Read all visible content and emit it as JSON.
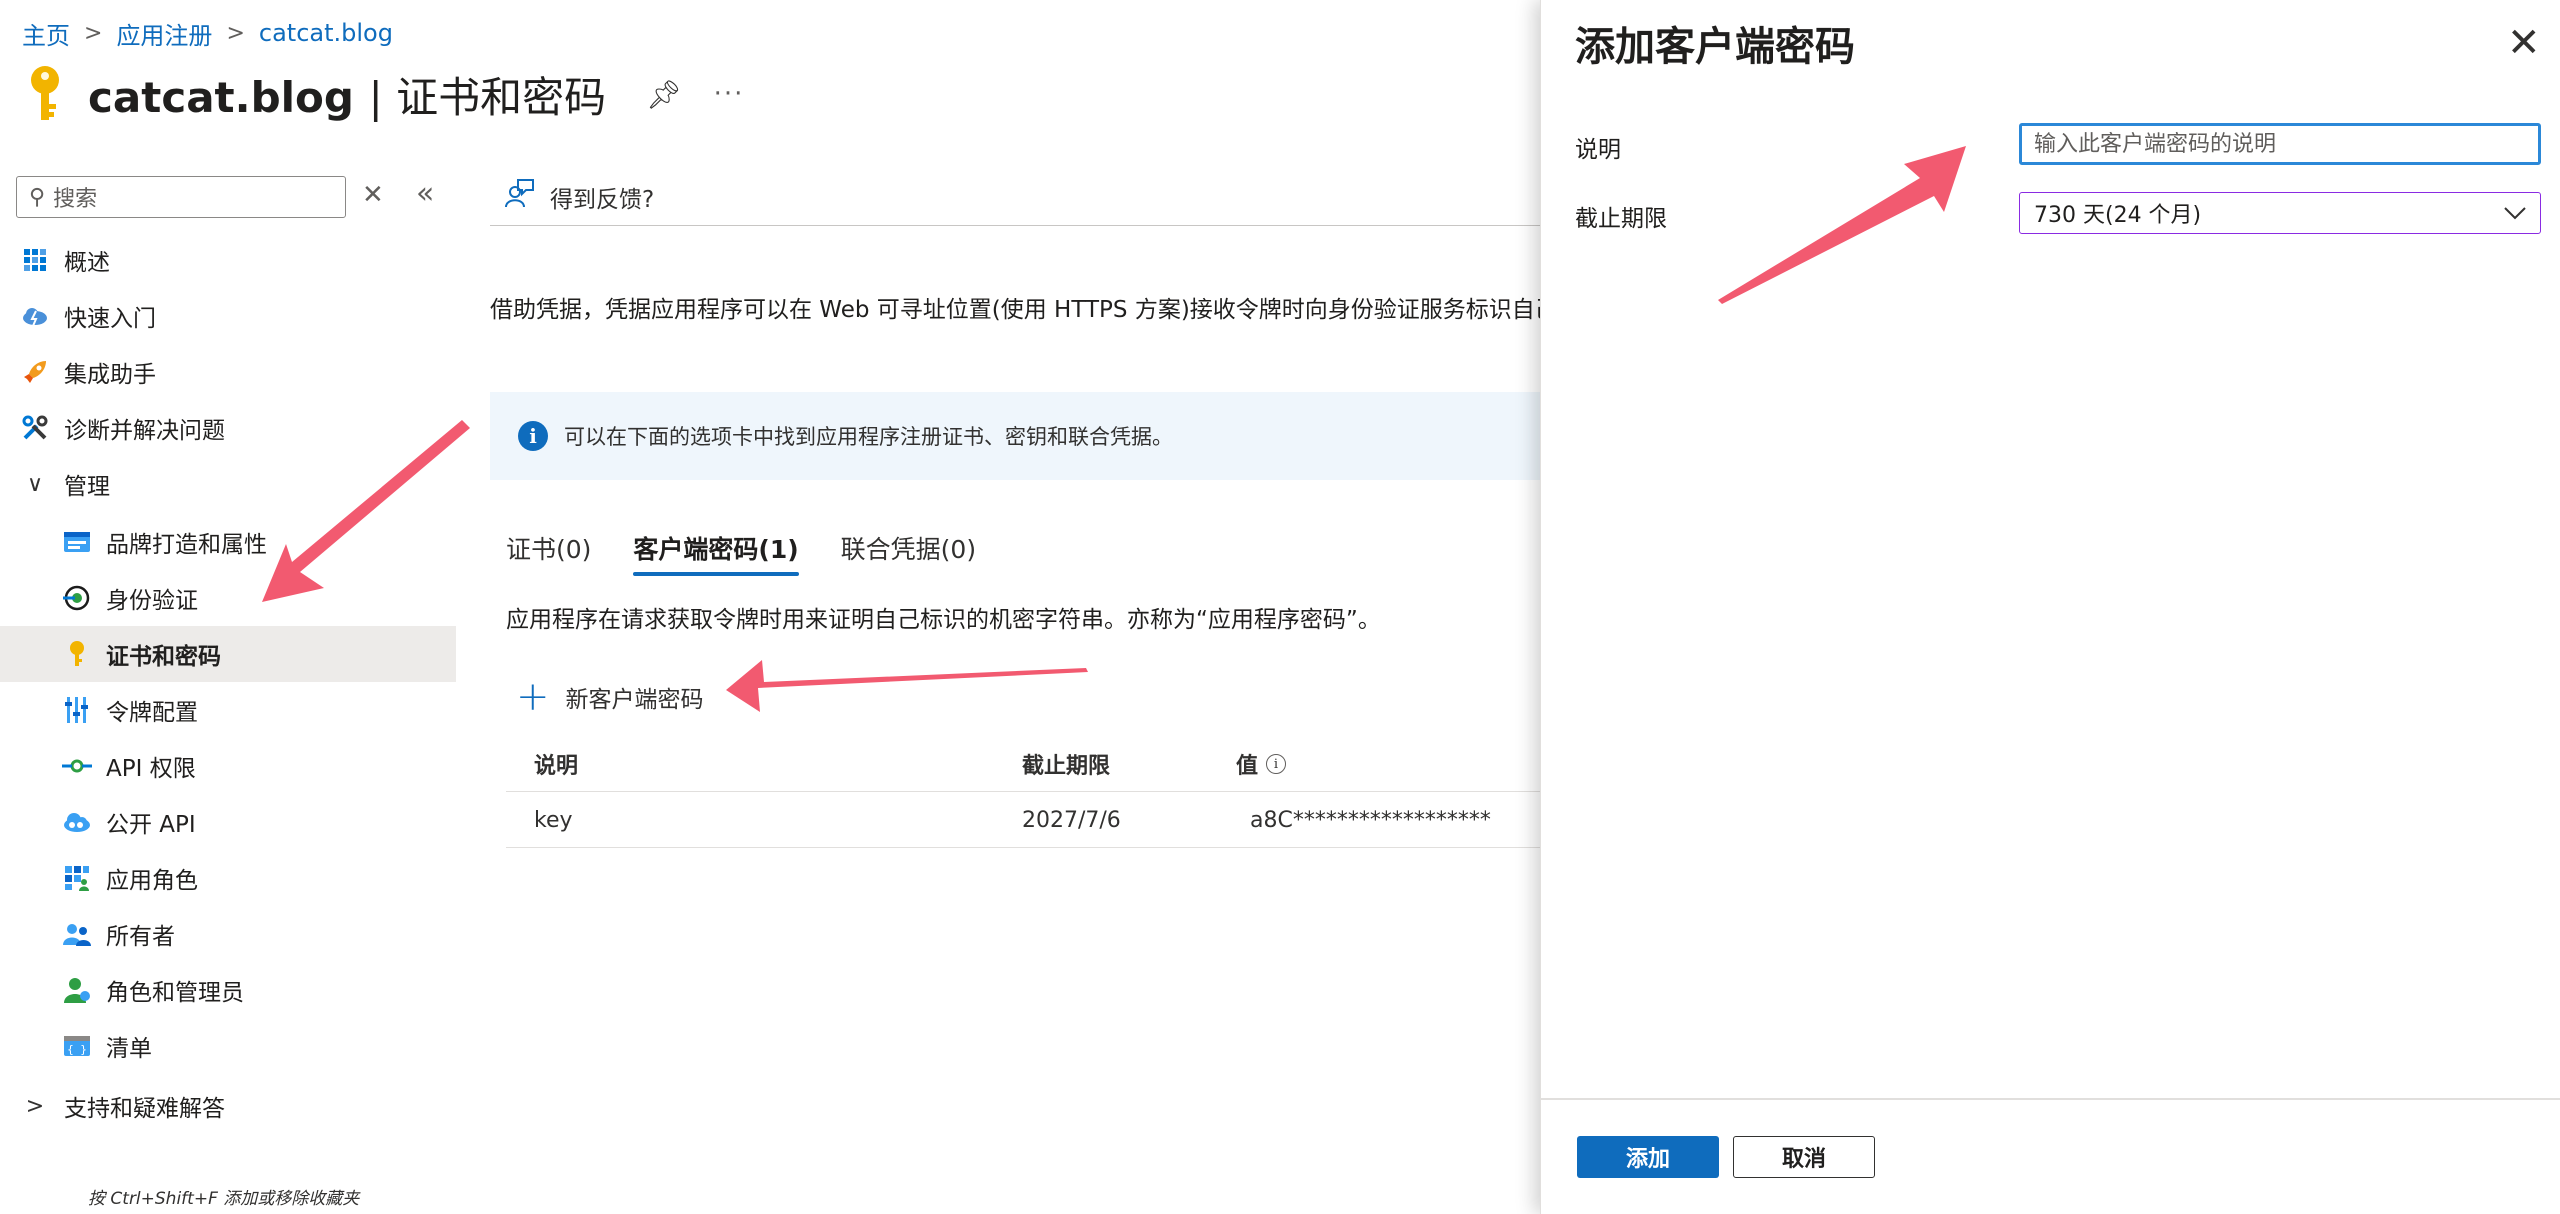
{
  "breadcrumb": {
    "home": "主页",
    "app_reg": "应用注册",
    "current": "catcat.blog"
  },
  "page": {
    "app_name": "catcat.blog",
    "section_title": "| 证书和密码"
  },
  "search": {
    "placeholder": "搜索"
  },
  "nav": {
    "overview": "概述",
    "quickstart": "快速入门",
    "integration": "集成助手",
    "diagnose": "诊断并解决问题",
    "manage": "管理",
    "branding": "品牌打造和属性",
    "auth": "身份验证",
    "certs": "证书和密码",
    "token": "令牌配置",
    "api_perm": "API 权限",
    "expose_api": "公开 API",
    "app_roles": "应用角色",
    "owners": "所有者",
    "roles_admins": "角色和管理员",
    "manifest": "清单",
    "support": "支持和疑难解答"
  },
  "footer_hint": "按 Ctrl+Shift+F 添加或移除收藏夹",
  "main": {
    "feedback": "得到反馈?",
    "description": "借助凭据，凭据应用程序可以在 Web 可寻址位置(使用 HTTPS 方案)接收令牌时向身份验证服务标识自己",
    "info": "可以在下面的选项卡中找到应用程序注册证书、密钥和联合凭据。",
    "tabs": [
      "证书(0)",
      "客户端密码(1)",
      "联合凭据(0)"
    ],
    "tab_desc": "应用程序在请求获取令牌时用来证明自己标识的机密字符串。亦称为“应用程序密码”。",
    "new_secret": "新客户端密码",
    "columns": {
      "desc": "说明",
      "expires": "截止期限",
      "value": "值"
    },
    "rows": [
      {
        "desc": "key",
        "expires": "2027/7/6",
        "value": "a8C******************"
      }
    ]
  },
  "panel": {
    "title": "添加客户端密码",
    "desc_label": "说明",
    "desc_placeholder": "输入此客户端密码的说明",
    "expiry_label": "截止期限",
    "expiry_value": "730 天(24 个月)",
    "add": "添加",
    "cancel": "取消"
  },
  "colors": {
    "accent": "#0f6cbd",
    "annotation": "#f25a70"
  }
}
